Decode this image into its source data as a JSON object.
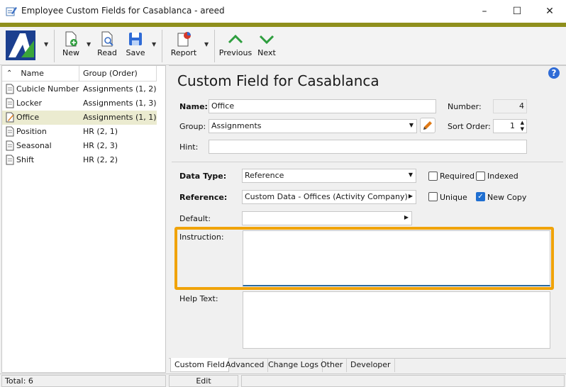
{
  "window": {
    "title": "Employee Custom Fields for Casablanca - areed"
  },
  "toolbar": {
    "new_label": "New",
    "read_label": "Read",
    "save_label": "Save",
    "report_label": "Report",
    "previous_label": "Previous",
    "next_label": "Next"
  },
  "list": {
    "col_name": "Name",
    "col_group": "Group (Order)",
    "rows": [
      {
        "name": "Cubicle Number",
        "group": "Assignments (1, 2)"
      },
      {
        "name": "Locker",
        "group": "Assignments (1, 3)"
      },
      {
        "name": "Office",
        "group": "Assignments (1, 1)"
      },
      {
        "name": "Position",
        "group": "HR (2, 1)"
      },
      {
        "name": "Seasonal",
        "group": "HR (2, 3)"
      },
      {
        "name": "Shift",
        "group": "HR (2, 2)"
      }
    ]
  },
  "form": {
    "heading": "Custom Field for Casablanca",
    "name_label": "Name:",
    "name_value": "Office",
    "number_label": "Number:",
    "number_value": "4",
    "group_label": "Group:",
    "group_value": "Assignments",
    "sort_order_label": "Sort Order:",
    "sort_order_value": "1",
    "hint_label": "Hint:",
    "hint_value": "",
    "data_type_label": "Data Type:",
    "data_type_value": "Reference",
    "required_label": "Required",
    "indexed_label": "Indexed",
    "reference_label": "Reference:",
    "reference_value": "Custom Data - Offices (Activity Company)",
    "unique_label": "Unique",
    "new_copy_label": "New Copy",
    "default_label": "Default:",
    "default_value": "",
    "instruction_label": "Instruction:",
    "instruction_value": "",
    "help_text_label": "Help Text:",
    "help_text_value": ""
  },
  "tabs": [
    "Custom Field",
    "Advanced",
    "Change Logs",
    "Other",
    "Developer"
  ],
  "status": {
    "total": "Total: 6",
    "mode": "Edit"
  },
  "colors": {
    "accent_olive": "#8f8f1c",
    "highlight_orange": "#f0a30a",
    "selection": "#ebebd0"
  }
}
